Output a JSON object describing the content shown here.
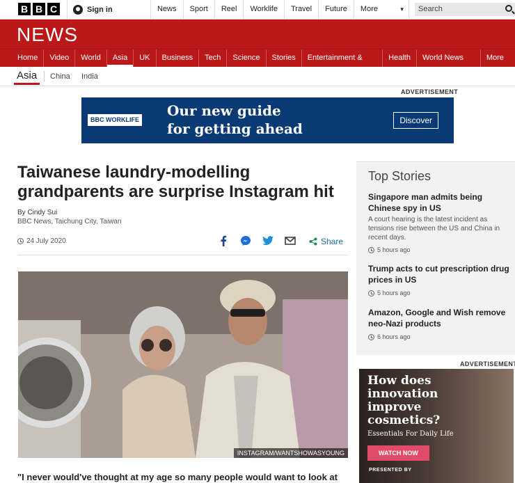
{
  "top": {
    "logo_letters": [
      "B",
      "B",
      "C"
    ],
    "signin": "Sign in",
    "nav": [
      "News",
      "Sport",
      "Reel",
      "Worklife",
      "Travel",
      "Future"
    ],
    "more": "More",
    "search_placeholder": "Search"
  },
  "news_title": "NEWS",
  "main_nav": [
    "Home",
    "Video",
    "World",
    "Asia",
    "UK",
    "Business",
    "Tech",
    "Science",
    "Stories",
    "Entertainment & Arts",
    "Health",
    "World News TV"
  ],
  "main_nav_more": "More ▾",
  "sub_nav": {
    "current": "Asia",
    "items": [
      "China",
      "India"
    ]
  },
  "ad_label": "ADVERTISEMENT",
  "banner_ad": {
    "badge": "BBC WORKLIFE",
    "line1": "Our new guide",
    "line2": "for getting ahead",
    "cta": "Discover"
  },
  "article": {
    "headline": "Taiwanese laundry-modelling grandparents are surprise Instagram hit",
    "author": "By Cindy Sui",
    "location": "BBC News, Taichung City, Taiwan",
    "date": "24 July 2020",
    "share": "Share",
    "photo_credit": "INSTAGRAM/WANTSHOWASYOUNG",
    "quote": "\"I never would've thought at my age so many people would want to look at"
  },
  "top_stories": {
    "title": "Top Stories",
    "items": [
      {
        "headline": "Singapore man admits being Chinese spy in US",
        "summary": "A court hearing is the latest incident as tensions rise between the US and China in recent days.",
        "time": "5 hours ago"
      },
      {
        "headline": "Trump acts to cut prescription drug prices in US",
        "summary": "",
        "time": "5 hours ago"
      },
      {
        "headline": "Amazon, Google and Wish remove neo-Nazi products",
        "summary": "",
        "time": "6 hours ago"
      }
    ]
  },
  "side_ad": {
    "label": "ADVERTISEMENT",
    "headline": "How does innovation improve cosmetics?",
    "sub": "Essentials For Daily Life",
    "cta": "WATCH NOW",
    "presented": "PRESENTED BY"
  },
  "colors": {
    "brand_red": "#bb1919",
    "ad_blue": "#0a3a75",
    "share_blue": "#1d6fa5"
  }
}
